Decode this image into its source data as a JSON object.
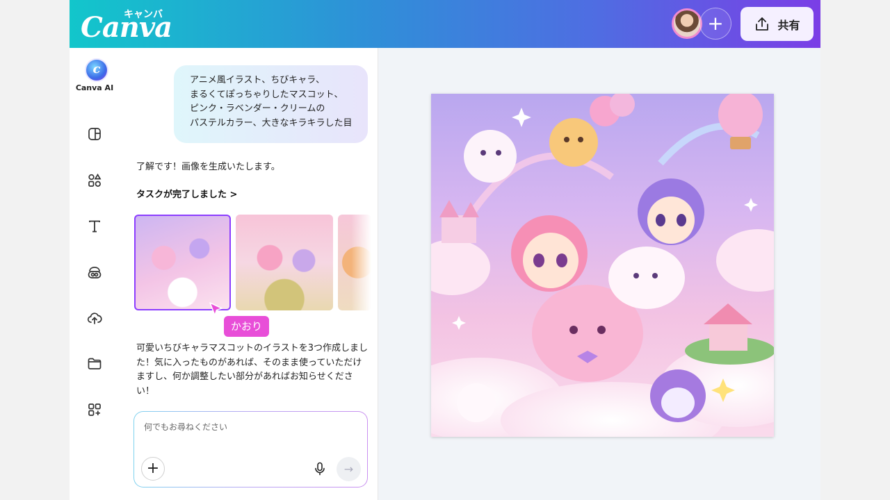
{
  "brand": {
    "logo_script": "Canva",
    "logo_kana": "キャンバ"
  },
  "header": {
    "share_label": "共有",
    "colors": {
      "gradient_start": "#12c6cb",
      "gradient_end": "#7b3ee6"
    }
  },
  "rail": {
    "ai_label": "Canva AI",
    "items": [
      "design-icon",
      "elements-icon",
      "text-icon",
      "brand-icon",
      "upload-icon",
      "folder-icon",
      "apps-icon"
    ]
  },
  "chat": {
    "user_prompt_lines": [
      "アニメ風イラスト、ちびキャラ、",
      "まるくてぽっちゃりしたマスコット、",
      "ピンク・ラベンダー・クリームの",
      "パステルカラー、大きなキラキラした目"
    ],
    "reply": "了解です！画像を生成いたします。",
    "task_done": "タスクが完了しました >",
    "collaborator_tag": "かおり",
    "description": "可愛いちびキャラマスコットのイラストを3つ作成しました！気に入ったものがあれば、そのまま使っていただけますし、何か調整したい部分があればお知らせください！"
  },
  "composer": {
    "placeholder": "何でもお尋ねください"
  }
}
